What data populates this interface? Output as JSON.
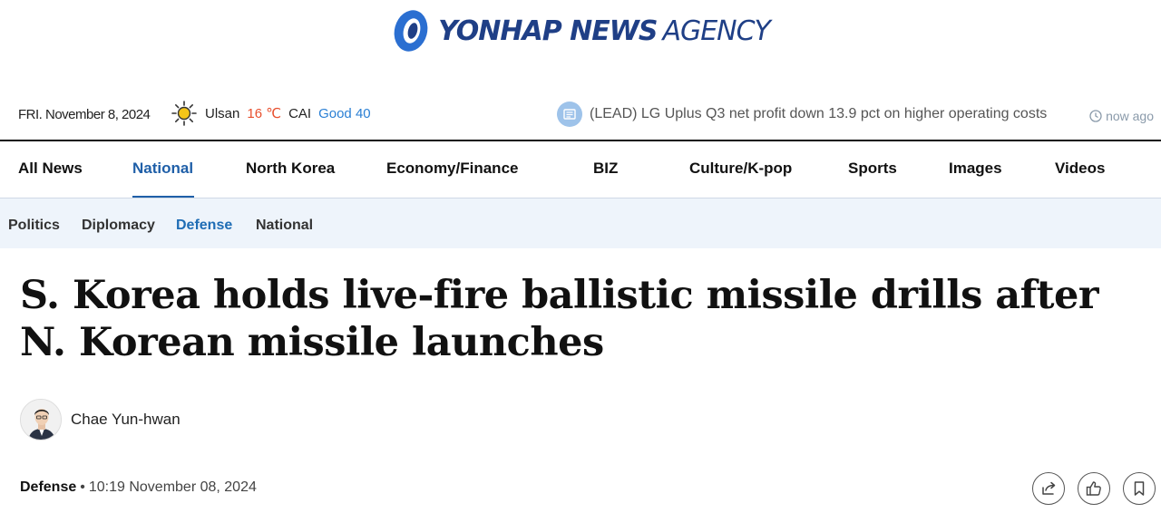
{
  "logo": {
    "brand_bold": "YONHAP NEWS",
    "brand_light": "AGENCY",
    "colors": {
      "primary": "#1f3f86",
      "accent": "#2b6fd1"
    }
  },
  "infobar": {
    "date": "FRI. November 8, 2024",
    "weather": {
      "icon": "sun-icon",
      "city": "Ulsan",
      "temperature": "16 ℃",
      "cai_label": "CAI",
      "cai_value": "Good 40"
    },
    "ticker": {
      "icon": "news-icon",
      "text": "(LEAD) LG Uplus Q3 net profit down 13.9 pct on higher operating costs"
    },
    "time_ago": "now ago"
  },
  "main_nav": {
    "items": [
      {
        "label": "All News"
      },
      {
        "label": "National",
        "active": true
      },
      {
        "label": "North Korea"
      },
      {
        "label": "Economy/Finance"
      },
      {
        "label": "BIZ"
      },
      {
        "label": "Culture/K-pop"
      },
      {
        "label": "Sports"
      },
      {
        "label": "Images"
      },
      {
        "label": "Videos"
      }
    ]
  },
  "sub_nav": {
    "items": [
      {
        "label": "Politics"
      },
      {
        "label": "Diplomacy"
      },
      {
        "label": "Defense",
        "active": true
      },
      {
        "label": "National"
      }
    ]
  },
  "article": {
    "headline": "S. Korea holds live-fire ballistic missile drills after N. Korean missile launches",
    "author": "Chae Yun-hwan",
    "category": "Defense",
    "separator": "•",
    "timestamp": "10:19 November 08, 2024",
    "actions": [
      "share-icon",
      "like-icon",
      "bookmark-icon"
    ]
  }
}
